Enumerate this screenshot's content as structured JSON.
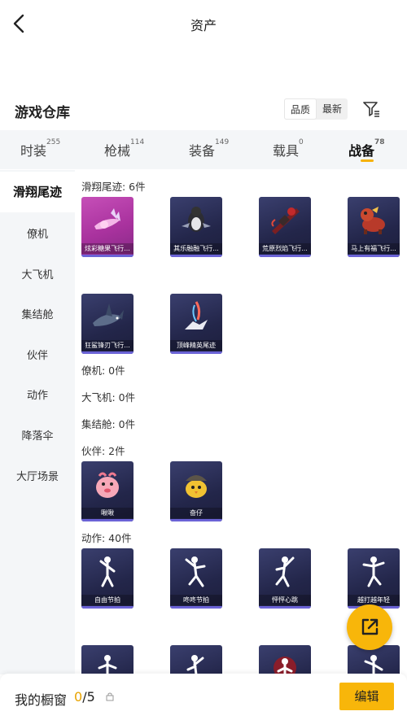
{
  "header": {
    "title": "资产"
  },
  "section": {
    "title": "游戏仓库",
    "sort_quality": "品质",
    "sort_newest": "最新"
  },
  "tabs": [
    {
      "label": "时装",
      "count": "255"
    },
    {
      "label": "枪械",
      "count": "114"
    },
    {
      "label": "装备",
      "count": "149"
    },
    {
      "label": "载具",
      "count": "0"
    },
    {
      "label": "战备",
      "count": "78"
    }
  ],
  "sidebar": [
    "滑翔尾迹",
    "僚机",
    "大飞机",
    "集结舱",
    "伙伴",
    "动作",
    "降落伞",
    "大厅场景"
  ],
  "categories": {
    "trail": "滑翔尾迹: 6件",
    "wingman": "僚机: 0件",
    "plane": "大飞机: 0件",
    "pod": "集结舱: 0件",
    "partner": "伙伴: 2件",
    "emote": "动作: 40件"
  },
  "trail_items": [
    "炫彩糖果飞行...",
    "其乐融融飞行...",
    "荒原烈焰飞行...",
    "马上有福飞行...",
    "狂鲨锋刃飞行...",
    "顶峰精英尾迹"
  ],
  "partner_items": [
    "啾啾",
    "奋仔"
  ],
  "emote_items": [
    "自由节拍",
    "咚咚节拍",
    "怦怦心跳",
    "越打越年轻"
  ],
  "bottom": {
    "showcase_label": "我的橱窗",
    "showcase_current": "0",
    "showcase_total": "/5",
    "edit_label": "编辑"
  },
  "colors": {
    "accent": "#f8b60a",
    "tile_dark": "#23264a",
    "tile_pink": "#a9329e"
  }
}
